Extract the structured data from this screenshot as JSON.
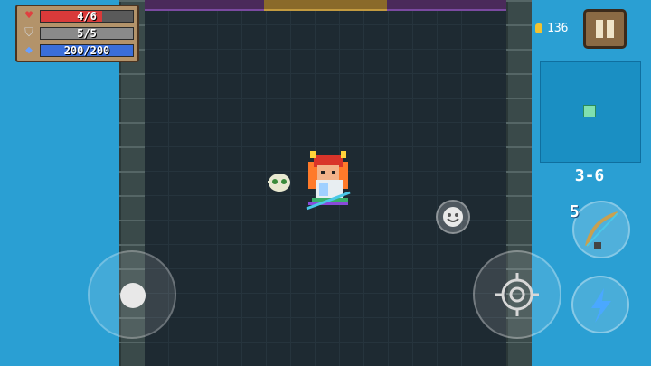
{
  "hud": {
    "health": {
      "text": "4/6",
      "value": 4,
      "max": 6,
      "color": "#d93a3a"
    },
    "armor": {
      "text": "5/5",
      "value": 5,
      "max": 5,
      "color": "#8a8a8a"
    },
    "energy": {
      "text": "200/200",
      "value": 200,
      "max": 200,
      "color": "#3a6ed9"
    },
    "coins": "136",
    "level": "3-6",
    "weapon_energy_cost": "5"
  },
  "icons": {
    "health": "heart-icon",
    "armor": "shield-icon",
    "energy": "diamond-icon",
    "coin": "coin-icon",
    "pause": "pause-icon",
    "emote": "smiley-icon",
    "attack": "crosshair-icon",
    "skill": "lightning-icon",
    "weapon": "bow-icon"
  },
  "colors": {
    "water": "#2a9fd3",
    "floor": "#1e2a32",
    "minimap": "#1a8fc3",
    "skill_bolt": "#4aa8ff"
  }
}
